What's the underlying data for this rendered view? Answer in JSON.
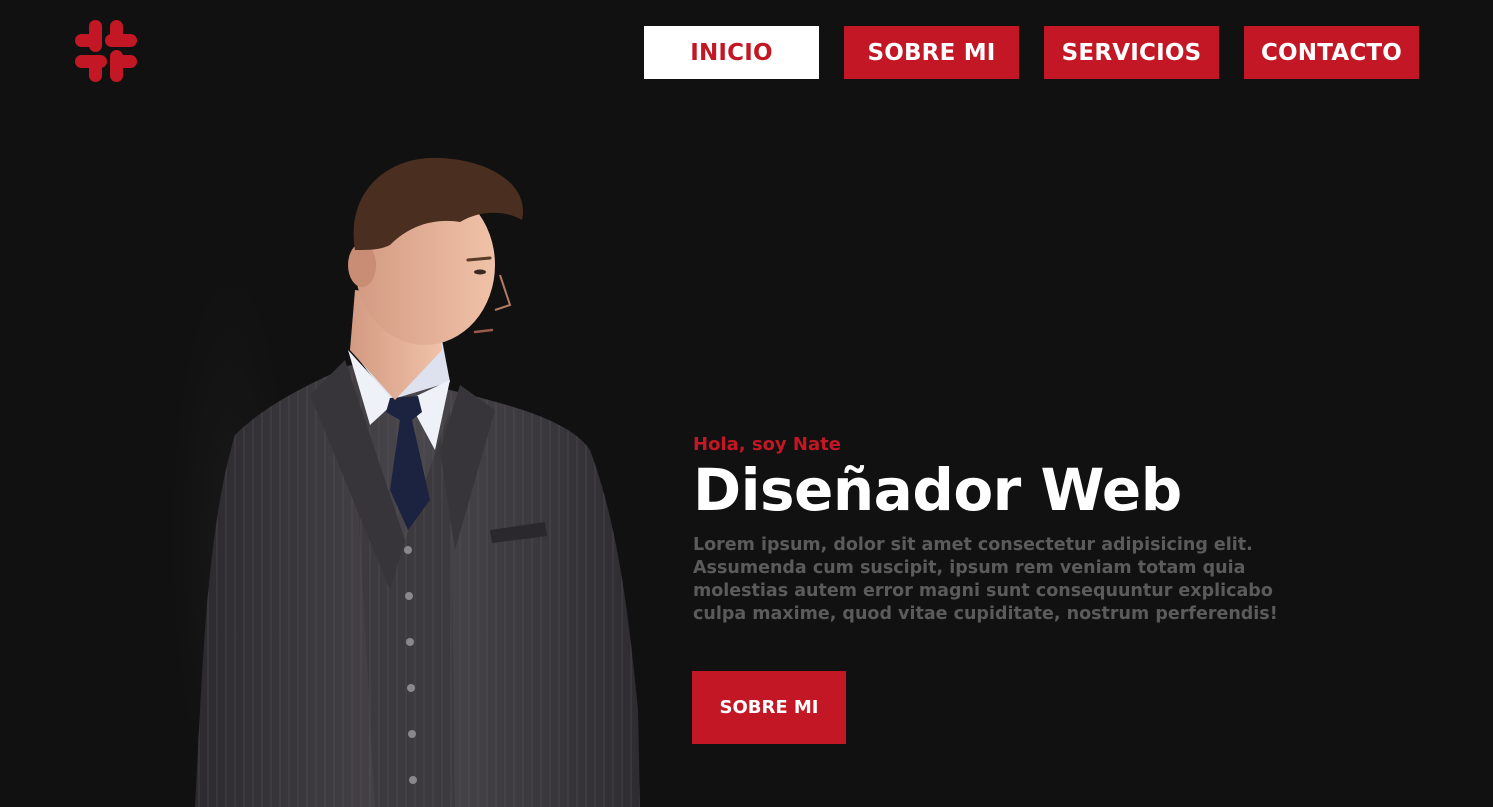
{
  "brand": {
    "logo_icon": "hash-logo-icon",
    "accent": "#c41725",
    "background": "#111111"
  },
  "nav": {
    "items": [
      {
        "label": "INICIO",
        "active": true
      },
      {
        "label": "SOBRE MI",
        "active": false
      },
      {
        "label": "SERVICIOS",
        "active": false
      },
      {
        "label": "CONTACTO",
        "active": false
      }
    ]
  },
  "hero": {
    "greeting": "Hola, soy Nate",
    "title": "Diseñador Web",
    "description": "Lorem ipsum, dolor sit amet consectetur adipisicing elit. Assumenda cum suscipit, ipsum rem veniam totam quia molestias autem error magni sunt consequuntur explicabo culpa maxime, quod vitae cupiditate, nostrum perferendis!",
    "cta_label": "SOBRE MI",
    "photo": "man-in-grey-suit-photo"
  }
}
